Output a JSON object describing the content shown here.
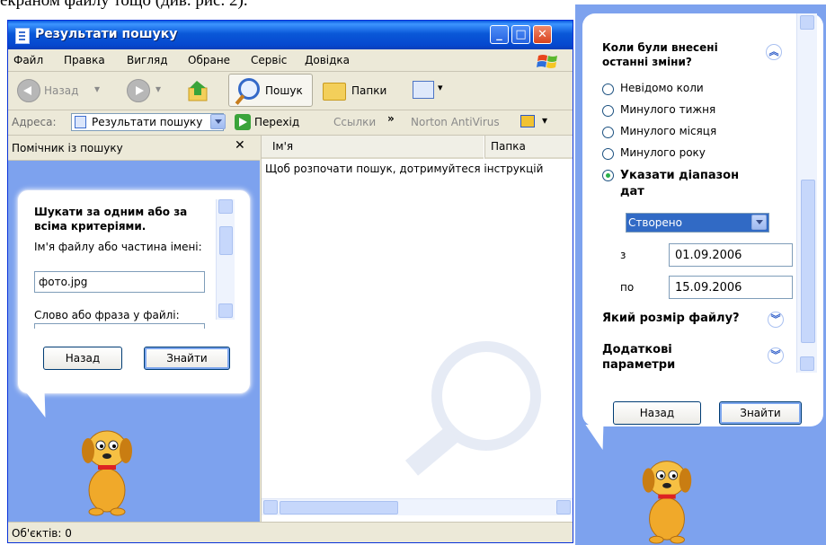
{
  "document": {
    "caption": "екраном файлу тощо (див. рис. 2)."
  },
  "window": {
    "title": "Результати пошуку",
    "menu": [
      "Файл",
      "Правка",
      "Вигляд",
      "Обране",
      "Сервіс",
      "Довідка"
    ],
    "toolbar": {
      "back": "Назад",
      "search": "Пошук",
      "folders": "Папки"
    },
    "address": {
      "label": "Адреса:",
      "value": "Результати пошуку",
      "go": "Перехід",
      "links": "Ссылки",
      "antivirus": "Norton AntiVirus"
    },
    "left_pane": {
      "header": "Помічник із пошуку",
      "heading": "Шукати за одним або за всіма критеріями.",
      "filename_label": "Ім'я файлу або частина імені:",
      "filename_value": "фото.jpg",
      "phrase_label": "Слово або фраза у файлі:",
      "back_button": "Назад",
      "find_button": "Знайти"
    },
    "results": {
      "columns": [
        "Ім'я",
        "Папка"
      ],
      "message": "Щоб розпочати пошук, дотримуйтеся інструкцій"
    },
    "status": "Об'єктів: 0"
  },
  "assistant_pane": {
    "section_when": "Коли були внесені останні зміни?",
    "options": [
      "Невідомо коли",
      "Минулого тижня",
      "Минулого місяця",
      "Минулого року",
      "Указати діапазон дат"
    ],
    "selected_option": "Указати діапазон дат",
    "date_type": "Створено",
    "from_label": "з",
    "from_date": "01.09.2006",
    "to_label": "по",
    "to_date": "15.09.2006",
    "section_size": "Який розмір файлу?",
    "section_extra": "Додаткові параметри",
    "back_button": "Назад",
    "find_button": "Знайти"
  },
  "colors": {
    "title_blue": "#0a58d8",
    "pane_blue": "#7da2ee",
    "close_red": "#d8421e"
  },
  "icons": [
    "search-icon",
    "folder-icon",
    "views-icon",
    "dog-assistant-icon"
  ]
}
